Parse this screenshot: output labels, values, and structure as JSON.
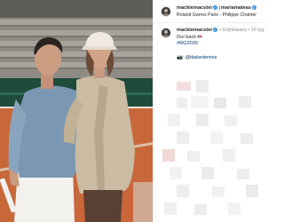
{
  "post": {
    "author": "mackiemacster",
    "collaborator": "mariamateas",
    "location": "Roland Garros Paris - Philippe Chatrier"
  },
  "caption": {
    "author": "mackiemacster",
    "edited_label": "• Edytowany",
    "time": "• 16 tyg.",
    "text": "Oui back",
    "hashtag": "#RG2026",
    "credit_prefix": "📷:",
    "credit_mention": "@ittakestennis"
  },
  "colors": {
    "verified": "#3897f0",
    "link": "#00376b",
    "muted": "#8e8e8e",
    "clay": "#c8683a"
  },
  "icons": [
    "verified-badge-icon",
    "france-flag-icon",
    "camera-icon"
  ]
}
